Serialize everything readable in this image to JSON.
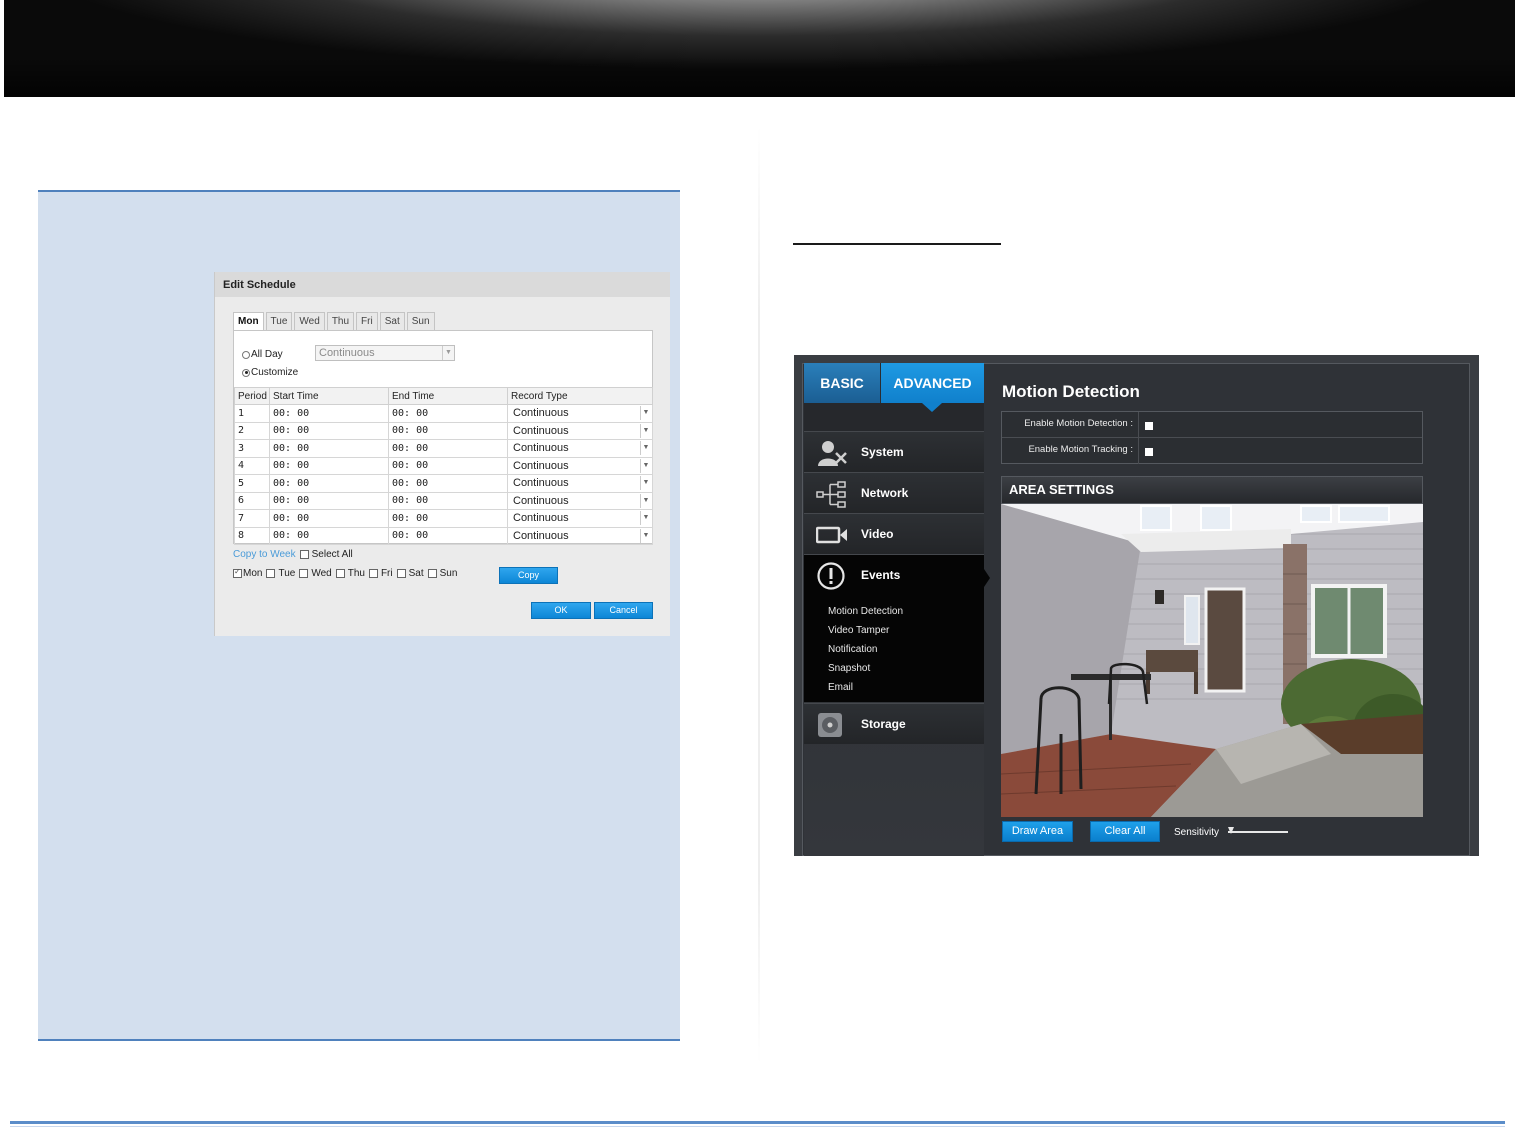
{
  "edit_schedule": {
    "title": "Edit Schedule",
    "tabs": [
      "Mon",
      "Tue",
      "Wed",
      "Thu",
      "Fri",
      "Sat",
      "Sun"
    ],
    "active_tab": "Mon",
    "all_day_label": "All Day",
    "all_day_select": "Continuous",
    "customize_label": "Customize",
    "columns": [
      "Period",
      "Start Time",
      "End Time",
      "Record Type"
    ],
    "rows": [
      {
        "period": "1",
        "start": "00: 00",
        "end": "00: 00",
        "type": "Continuous"
      },
      {
        "period": "2",
        "start": "00: 00",
        "end": "00: 00",
        "type": "Continuous"
      },
      {
        "period": "3",
        "start": "00: 00",
        "end": "00: 00",
        "type": "Continuous"
      },
      {
        "period": "4",
        "start": "00: 00",
        "end": "00: 00",
        "type": "Continuous"
      },
      {
        "period": "5",
        "start": "00: 00",
        "end": "00: 00",
        "type": "Continuous"
      },
      {
        "period": "6",
        "start": "00: 00",
        "end": "00: 00",
        "type": "Continuous"
      },
      {
        "period": "7",
        "start": "00: 00",
        "end": "00: 00",
        "type": "Continuous"
      },
      {
        "period": "8",
        "start": "00: 00",
        "end": "00: 00",
        "type": "Continuous"
      }
    ],
    "copy_to_week": "Copy to Week",
    "select_all": "Select All",
    "copy_days": [
      "Mon",
      "Tue",
      "Wed",
      "Thu",
      "Fri",
      "Sat",
      "Sun"
    ],
    "copy_button": "Copy",
    "ok_button": "OK",
    "cancel_button": "Cancel"
  },
  "camera_ui": {
    "tab_basic": "BASIC",
    "tab_advanced": "ADVANCED",
    "nav": [
      {
        "label": "System",
        "icon": "system-icon"
      },
      {
        "label": "Network",
        "icon": "network-icon"
      },
      {
        "label": "Video",
        "icon": "video-icon"
      },
      {
        "label": "Events",
        "icon": "events-icon"
      },
      {
        "label": "Storage",
        "icon": "storage-icon"
      }
    ],
    "events_subitems": [
      "Motion Detection",
      "Video Tamper",
      "Notification",
      "Snapshot",
      "Email"
    ],
    "page_title": "Motion Detection",
    "enable_motion_detection": "Enable Motion Detection :",
    "enable_motion_tracking": "Enable Motion Tracking :",
    "area_settings": "AREA SETTINGS",
    "draw_area": "Draw Area",
    "clear_all": "Clear All",
    "sensitivity": "Sensitivity"
  }
}
